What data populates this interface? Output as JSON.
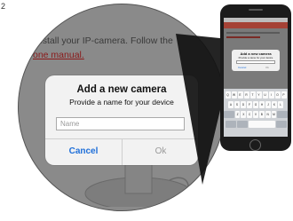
{
  "page": {
    "corner_mark": "2",
    "background_text_line1": "Install your IP-camera. Follow the",
    "background_text_line2": "one manual."
  },
  "dialog": {
    "title": "Add a new camera",
    "subtitle": "Provide a name for your device",
    "input_placeholder": "Name",
    "input_value": "",
    "cancel_label": "Cancel",
    "ok_label": "Ok"
  },
  "phone": {
    "mini_dialog_title": "Add a new camera",
    "mini_dialog_subtitle": "Provide a name for your device",
    "mini_cancel_label": "Cancel",
    "mini_ok_label": "Ok",
    "keyboard_rows": [
      [
        "Q",
        "W",
        "E",
        "R",
        "T",
        "Y",
        "U",
        "I",
        "O",
        "P"
      ],
      [
        "A",
        "S",
        "D",
        "F",
        "G",
        "H",
        "J",
        "K",
        "L"
      ],
      [
        "Z",
        "X",
        "C",
        "V",
        "B",
        "N",
        "M"
      ]
    ]
  },
  "colors": {
    "accent_blue": "#1e6fd9",
    "nav_red": "#a54236",
    "dim_overlay": "#8a8a8a"
  }
}
